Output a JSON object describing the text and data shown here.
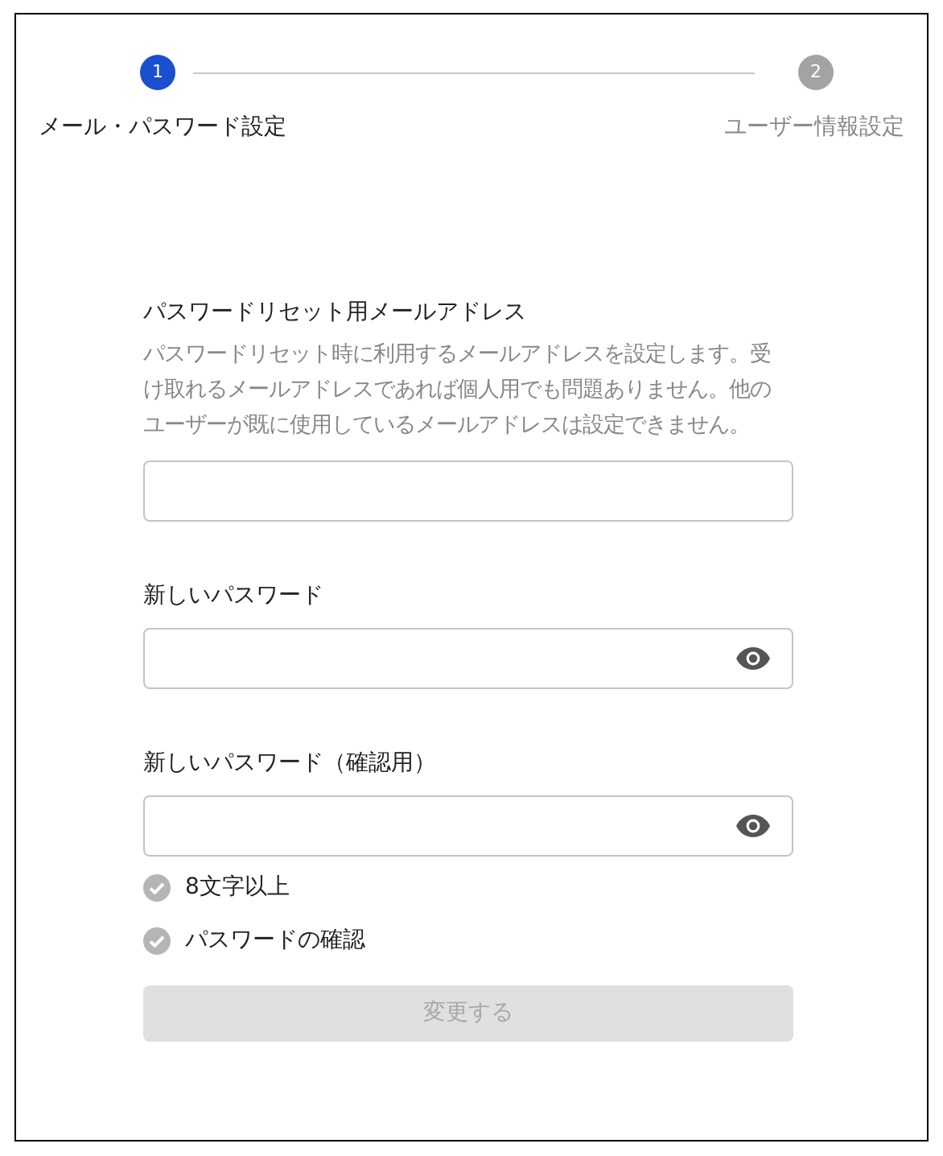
{
  "steps": [
    {
      "number": "1",
      "label": "メール・パスワード設定",
      "selected": true
    },
    {
      "number": "2",
      "label": "ユーザー情報設定",
      "selected": false
    }
  ],
  "fields": [
    {
      "label": "パスワードリセット用メールアドレス",
      "description": "パスワードリセット時に利用するメールアドレスを設定します。受け取れるメールアドレスであれば個人用でも問題ありません。他のユーザーが既に使用しているメールアドレスは設定できません。",
      "kind": "email"
    },
    {
      "label": "新しいパスワード",
      "kind": "password"
    },
    {
      "label": "新しいパスワード（確認用）",
      "kind": "password"
    }
  ],
  "checks": [
    {
      "label": "8文字以上",
      "checked": false
    },
    {
      "label": "パスワードの確認",
      "checked": false
    }
  ],
  "submit": {
    "label": "変更する",
    "disabled": true
  }
}
